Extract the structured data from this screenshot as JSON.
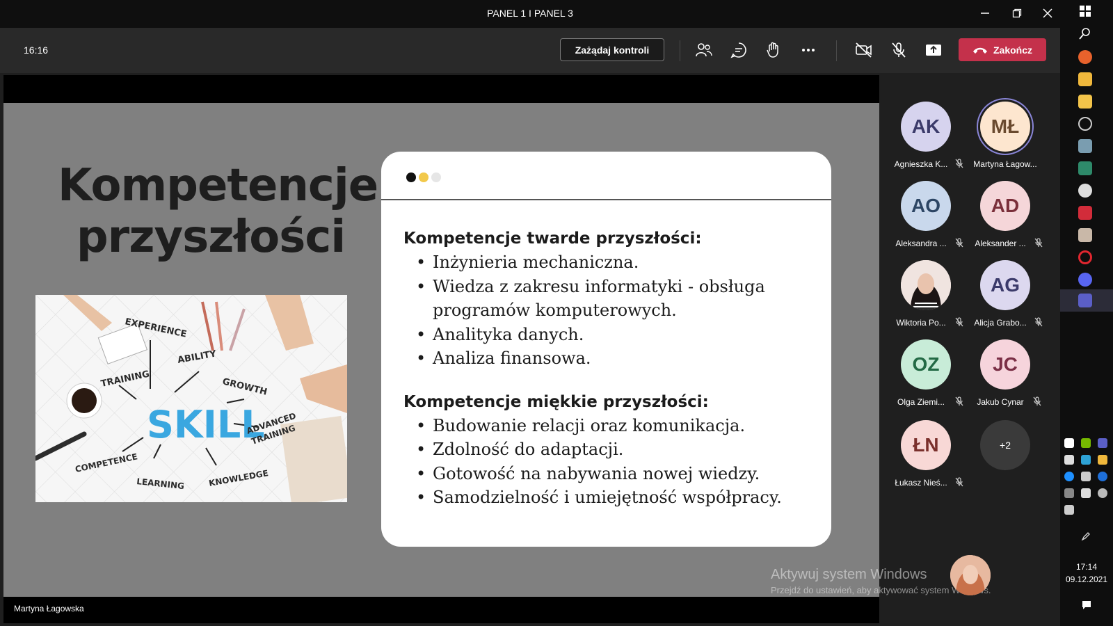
{
  "window": {
    "title": "PANEL 1 I PANEL 3"
  },
  "toolbar": {
    "time": "16:16",
    "request_control": "Zażądaj kontroli",
    "end_call": "Zakończ"
  },
  "slide": {
    "title_line1": "Kompetencje",
    "title_line2": "przyszłości",
    "image_words": [
      "EXPERIENCE",
      "ABILITY",
      "TRAINING",
      "GROWTH",
      "SKILL",
      "ADVANCED",
      "TRAINING",
      "COMPETENCE",
      "LEARNING",
      "KNOWLEDGE"
    ],
    "hard_heading": "Kompetencje twarde przyszłości:",
    "hard_items": [
      "Inżynieria mechaniczna.",
      "Wiedza z zakresu informatyki - obsługa programów komputerowych.",
      "Analityka danych.",
      "Analiza finansowa."
    ],
    "soft_heading": "Kompetencje miękkie przyszłości:",
    "soft_items": [
      "Budowanie relacji oraz komunikacja.",
      "Zdolność do adaptacji.",
      "Gotowość na nabywania nowej wiedzy.",
      "Samodzielność i umiejętność współpracy."
    ]
  },
  "presenter": "Martyna Łagowska",
  "participants": [
    {
      "initials": "AK",
      "name": "Agnieszka K...",
      "color": "#d6d3ee"
    },
    {
      "initials": "MŁ",
      "name": "Martyna Łagow...",
      "color": "#fde6cf"
    },
    {
      "initials": "AO",
      "name": "Aleksandra ...",
      "color": "#c9d8ec"
    },
    {
      "initials": "AD",
      "name": "Aleksander ...",
      "color": "#f5d6d9"
    },
    {
      "initials": "",
      "name": "Wiktoria Po...",
      "color": "#e9d2cc"
    },
    {
      "initials": "AG",
      "name": "Alicja Grabo...",
      "color": "#dcd8ef"
    },
    {
      "initials": "OZ",
      "name": "Olga Ziemi...",
      "color": "#c8ecd8"
    },
    {
      "initials": "JC",
      "name": "Jakub Cynar",
      "color": "#f6d4dc"
    },
    {
      "initials": "ŁN",
      "name": "Łukasz Nieś...",
      "color": "#f8d8d6"
    }
  ],
  "more_count": "+2",
  "watermark": {
    "line1": "Aktywuj system Windows",
    "line2": "Przejdź do ustawień, aby aktywować system Windows."
  },
  "taskbar": {
    "time": "17:14",
    "date": "09.12.2021"
  },
  "colors": {
    "end_call": "#c4314b",
    "accent_ring": "#8a86d8",
    "dot1": "#111111",
    "dot2": "#f2c94c",
    "dot3": "#e6e6e6"
  }
}
